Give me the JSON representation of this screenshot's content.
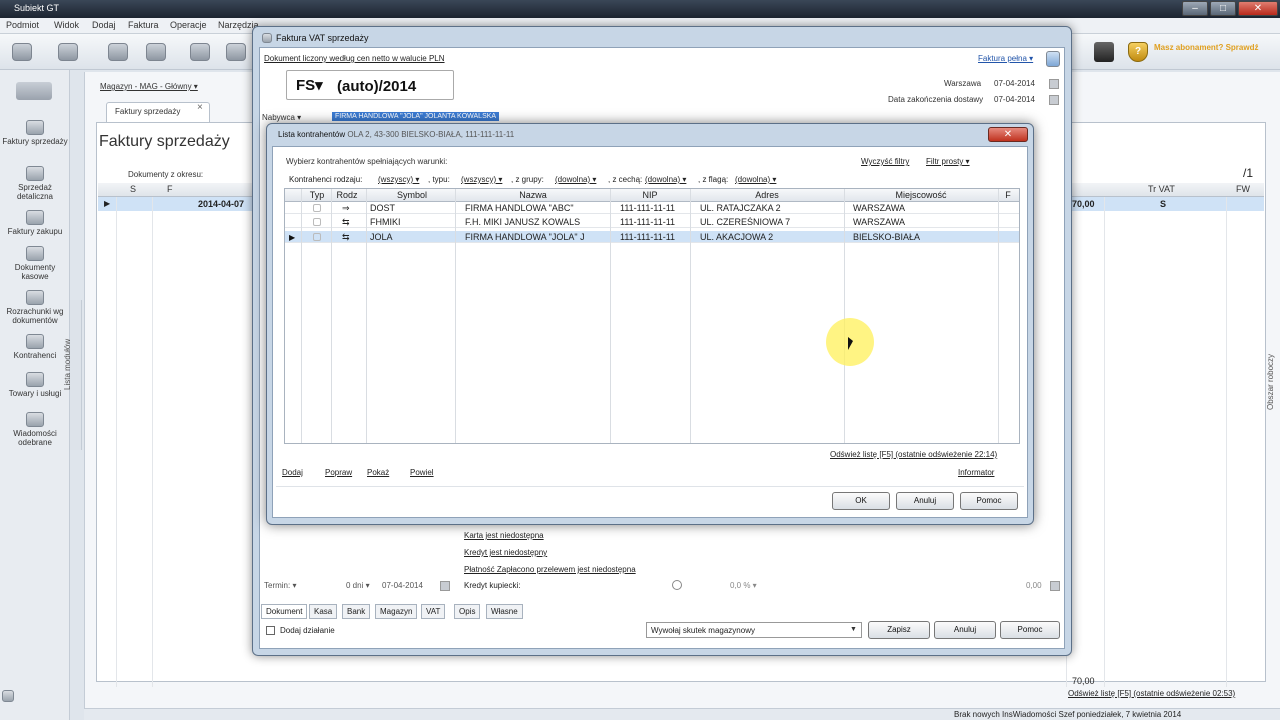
{
  "app": {
    "title": "Subiekt GT",
    "menu": [
      "Podmiot",
      "Widok",
      "Dodaj",
      "Faktura",
      "Operacje",
      "Narzędzia"
    ],
    "subscription_text": "Masz abonament? Sprawdź",
    "status_text": "Brak nowych InsWiadomości   Szef   poniedziałek, 7 kwietnia 2014"
  },
  "sidebar": {
    "items": [
      {
        "label": "Faktury sprzedaży"
      },
      {
        "label": "Sprzedaż detaliczna"
      },
      {
        "label": "Faktury zakupu"
      },
      {
        "label": "Dokumenty kasowe"
      },
      {
        "label": "Rozrachunki wg dokumentów"
      },
      {
        "label": "Kontrahenci"
      },
      {
        "label": "Towary i usługi"
      },
      {
        "label": "Wiadomości odebrane"
      }
    ],
    "tab_label": "Lista modułów"
  },
  "background": {
    "breadcrumb": "Magazyn - MAG - Główny ▾",
    "tab_label": "Faktury sprzedaży",
    "heading": "Faktury sprzedaży",
    "filter_label": "Dokumenty z okresu:",
    "columns": {
      "s": "S",
      "f": "F",
      "trvat": "Tr VAT",
      "fw": "FW"
    },
    "row_date": "2014-04-07",
    "row_amount": "70,00",
    "row_vat": "S",
    "page_indicator": "/1",
    "total": "70,00",
    "refresh_link": "Odśwież listę [F5] (ostatnie odświeżenie 02:53)",
    "right_tab_label": "Obszar roboczy"
  },
  "invoice": {
    "title": "Faktura VAT sprzedaży",
    "link_netto": "Dokument liczony według cen netto w walucie PLN",
    "link_full": "Faktura pełna ▾",
    "doc_type": "FS▾",
    "doc_number": "(auto)/2014",
    "place": "Warszawa",
    "issue_date": "07-04-2014",
    "delivery_label": "Data zakończenia dostawy",
    "delivery_date": "07-04-2014",
    "buyer_label": "Nabywca ▾",
    "buyer_value": "FIRMA HANDLOWA \"JOLA\" JOLANTA KOWALSKA",
    "links": [
      "Karta jest niedostępna",
      "Kredyt jest niedostępny",
      "Płatność Zapłacono przelewem jest niedostępna"
    ],
    "term_label": "Termin: ▾",
    "term_days": "0 dni ▾",
    "term_date": "07-04-2014",
    "credit_label": "Kredyt kupiecki:",
    "percent": "0,0 % ▾",
    "credit_amount": "0,00",
    "tabs": [
      "Dokument",
      "Kasa",
      "Bank",
      "Magazyn",
      "VAT",
      "Opis",
      "Własne"
    ],
    "add_action_label": "Dodaj działanie",
    "warehouse_select": "Wywołaj skutek magazynowy",
    "buttons": {
      "save": "Zapisz",
      "cancel": "Anuluj",
      "help": "Pomoc"
    }
  },
  "dialog": {
    "title": "Lista kontrahentów",
    "title_extra": "OLA 2, 43-300 BIELSKO-BIAŁA, 111-111-11-11",
    "heading": "Wybierz kontrahentów spełniających warunki:",
    "filters_link": "Wyczyść filtry",
    "quick_filter_link": "Filtr prosty ▾",
    "filter_row": [
      {
        "label": "Kontrahenci rodzaju:",
        "value": "(wszyscy) ▾"
      },
      {
        "label": ", typu:",
        "value": "(wszyscy) ▾"
      },
      {
        "label": ", z grupy:",
        "value": "(dowolna) ▾"
      },
      {
        "label": ", z cechą:",
        "value": "(dowolna) ▾"
      },
      {
        "label": ", z flagą:",
        "value": "(dowolna) ▾"
      }
    ],
    "columns": [
      "Typ",
      "Rodz",
      "Symbol",
      "Nazwa",
      "NIP",
      "Adres",
      "Miejscowość",
      "F"
    ],
    "rows": [
      {
        "typ": "",
        "rodz": "⇒",
        "symbol": "DOST",
        "nazwa": "FIRMA HANDLOWA \"ABC\"",
        "nip": "111-111-11-11",
        "adres": "UL. RATAJCZAKA 2",
        "miasto": "WARSZAWA"
      },
      {
        "typ": "",
        "rodz": "⇆",
        "symbol": "FHMIKI",
        "nazwa": "F.H. MIKI JANUSZ KOWALS",
        "nip": "111-111-11-11",
        "adres": "UL. CZEREŚNIOWA 7",
        "miasto": "WARSZAWA"
      },
      {
        "typ": "",
        "rodz": "⇆",
        "symbol": "JOLA",
        "nazwa": "FIRMA HANDLOWA \"JOLA\" J",
        "nip": "111-111-11-11",
        "adres": "UL. AKACJOWA 2",
        "miasto": "BIELSKO-BIAŁA"
      }
    ],
    "refresh_link": "Odśwież listę [F5] (ostatnie odświeżenie 22:14)",
    "informator": "Informator",
    "actions": [
      "Dodaj",
      "Popraw",
      "Pokaż",
      "Powiel"
    ],
    "buttons": {
      "ok": "OK",
      "cancel": "Anuluj",
      "help": "Pomoc"
    }
  }
}
